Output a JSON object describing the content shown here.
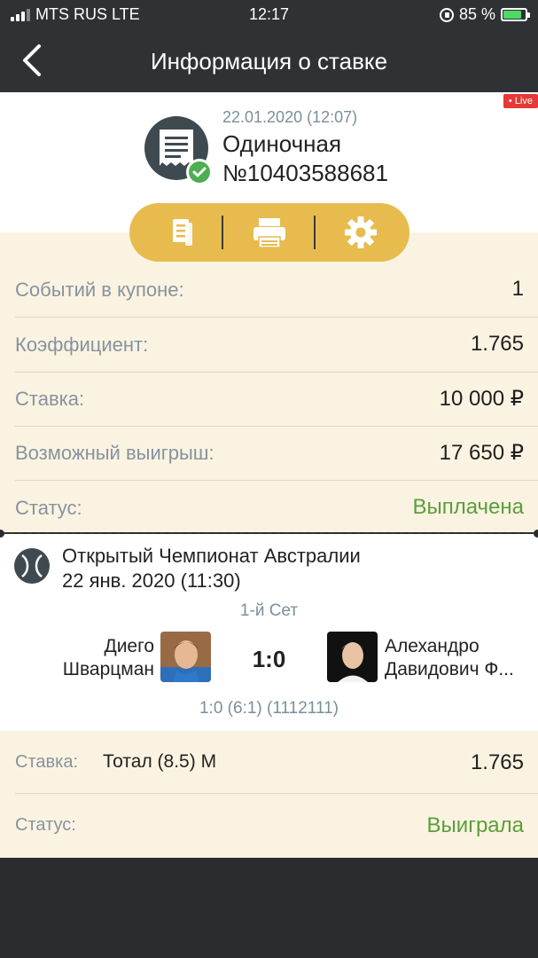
{
  "status_bar": {
    "carrier": "MTS RUS LTE",
    "time": "12:17",
    "battery": "85 %",
    "battery_level": 0.85
  },
  "nav": {
    "title": "Информация о ставке",
    "back_icon": "chevron-left-icon"
  },
  "header": {
    "live_badge": "• Live",
    "date": "22.01.2020 (12:07)",
    "type": "Одиночная",
    "number": "№10403588681",
    "ticket_icon": "receipt-icon",
    "check_icon": "check-circle-icon"
  },
  "actions": [
    {
      "name": "copy-button",
      "icon": "document-icon"
    },
    {
      "name": "print-button",
      "icon": "printer-icon"
    },
    {
      "name": "settings-button",
      "icon": "gear-icon"
    }
  ],
  "summary": {
    "events_label": "Событий в купоне:",
    "events_value": "1",
    "coef_label": "Коэффициент:",
    "coef_value": "1.765",
    "stake_label": "Ставка:",
    "stake_value": "10 000 ₽",
    "win_label": "Возможный выигрыш:",
    "win_value": "17 650 ₽",
    "status_label": "Статус:",
    "status_value": "Выплачена"
  },
  "event": {
    "sport_icon": "tennis-ball-icon",
    "tournament": "Открытый Чемпионат Австралии",
    "date": "22 янв. 2020 (11:30)",
    "period": "1-й Сет",
    "team1_line1": "Диего",
    "team1_line2": "Шварцман",
    "team2_line1": "Алехандро",
    "team2_line2": "Давидович Ф...",
    "score": "1:0",
    "score_detail": "1:0 (6:1) (1112111)"
  },
  "bet": {
    "stake_label": "Ставка:",
    "pick": "Тотал (8.5) М",
    "coef": "1.765",
    "status_label": "Статус:",
    "status_value": "Выиграла"
  },
  "colors": {
    "accent": "#e7bb4e",
    "dark": "#2f3235",
    "cream": "#fbf3e1",
    "win_green": "#5a9e3a",
    "live_red": "#e53935"
  }
}
